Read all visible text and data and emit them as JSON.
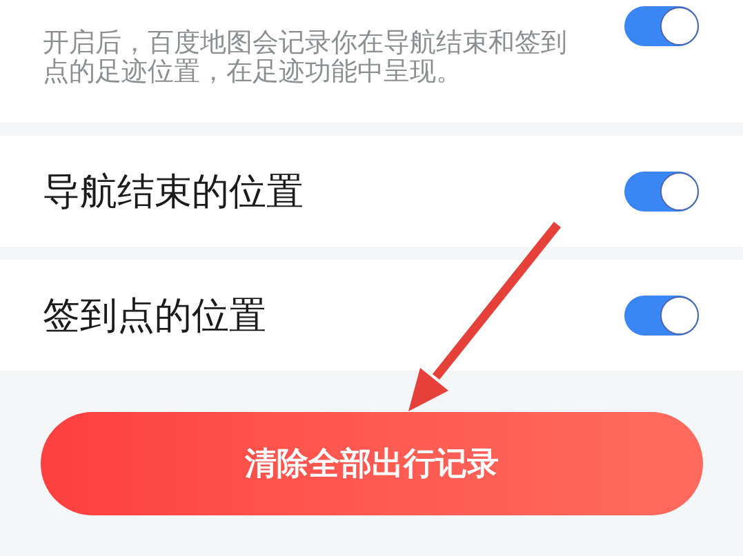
{
  "settings": [
    {
      "kind": "description",
      "description": "开启后，百度地图会记录你在导航结束和签到点的足迹位置，在足迹功能中呈现。",
      "on": true
    },
    {
      "kind": "label",
      "label": "导航结束的位置",
      "on": true
    },
    {
      "kind": "label",
      "label": "签到点的位置",
      "on": true
    }
  ],
  "clear_button": {
    "label": "清除全部出行记录"
  }
}
